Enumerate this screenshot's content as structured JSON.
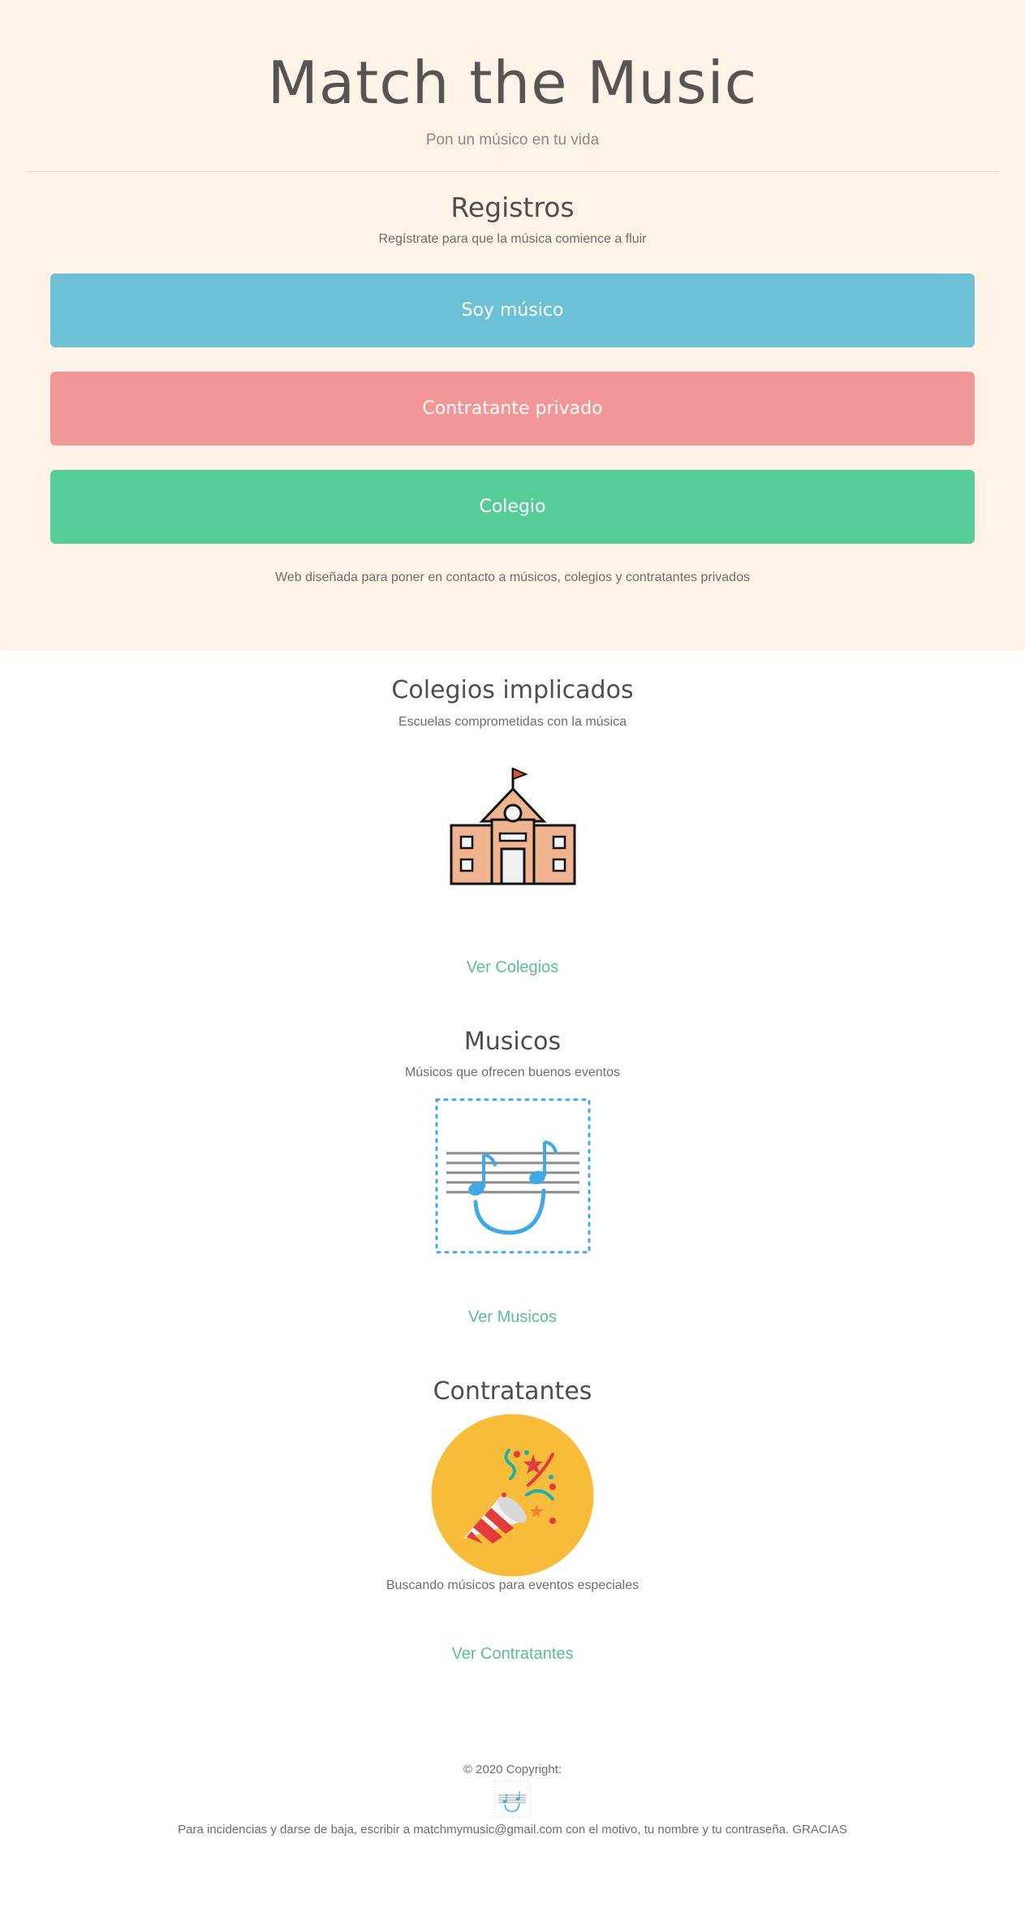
{
  "hero": {
    "title": "Match the Music",
    "subtitle": "Pon un músico en tu vida",
    "background": "#fff2e6"
  },
  "registros": {
    "title": "Registros",
    "subtitle": "Regístrate para que la música comience a fluir",
    "buttons": [
      {
        "label": "Soy músico",
        "color": "#6cc1d6"
      },
      {
        "label": "Contratante privado",
        "color": "#f29697"
      },
      {
        "label": "Colegio",
        "color": "#56cc99"
      }
    ],
    "footnote": "Web diseñada para poner en contacto a músicos, colegios y contratantes privados"
  },
  "colegios": {
    "title": "Colegios implicados",
    "subtitle": "Escuelas comprometidas con la música",
    "icon": "school-building-icon",
    "link": "Ver Colegios"
  },
  "musicos": {
    "title": "Musicos",
    "subtitle": "Músicos que ofrecen buenos eventos",
    "icon": "music-staff-icon",
    "link": "Ver Musicos"
  },
  "contratantes": {
    "title": "Contratantes",
    "subtitle": "Buscando músicos para eventos especiales",
    "icon": "party-popper-icon",
    "link": "Ver Contratantes"
  },
  "footer": {
    "copyright": "© 2020 Copyright:",
    "logo_icon": "music-logo-icon",
    "contact": "Para incidencias y darse de baja, escribir a matchmymusic@gmail.com con el motivo, tu nombre y tu contraseña. GRACIAS"
  },
  "colors": {
    "link": "#5dbb9b",
    "accent_blue": "#3fa9e8",
    "popper_bg": "#f8bc3a"
  }
}
